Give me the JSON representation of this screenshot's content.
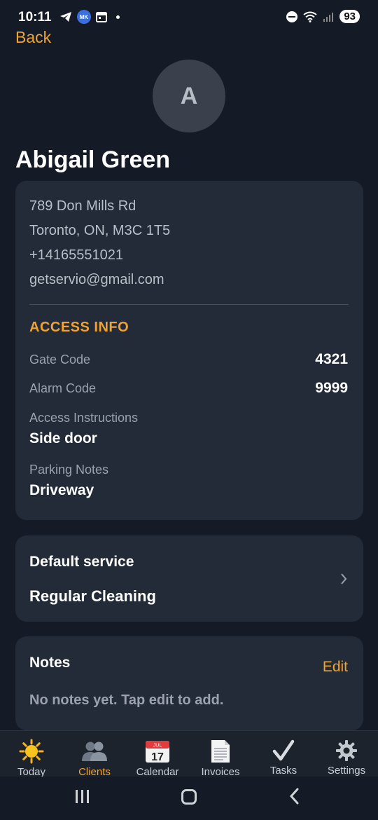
{
  "status": {
    "time": "10:11",
    "badge": "MK",
    "battery": "93"
  },
  "header": {
    "back_label": "Back"
  },
  "client": {
    "avatar_letter": "A",
    "name": "Abigail Green",
    "address_line1": "789 Don Mills Rd",
    "address_line2": "Toronto, ON, M3C 1T5",
    "phone": "+14165551021",
    "email": "getservio@gmail.com"
  },
  "access": {
    "title": "ACCESS INFO",
    "gate_label": "Gate Code",
    "gate_value": "4321",
    "alarm_label": "Alarm Code",
    "alarm_value": "9999",
    "instructions_label": "Access Instructions",
    "instructions_value": "Side door",
    "parking_label": "Parking Notes",
    "parking_value": "Driveway"
  },
  "service": {
    "label": "Default service",
    "value": "Regular Cleaning"
  },
  "notes": {
    "title": "Notes",
    "edit_label": "Edit",
    "empty_text": "No notes yet. Tap edit to add."
  },
  "tabs": [
    {
      "label": "Today",
      "icon": "sun-icon"
    },
    {
      "label": "Clients",
      "icon": "people-icon"
    },
    {
      "label": "Calendar",
      "icon": "calendar-icon",
      "date": "17",
      "month": "JUL"
    },
    {
      "label": "Invoices",
      "icon": "document-icon"
    },
    {
      "label": "Tasks",
      "icon": "checkmark-icon"
    },
    {
      "label": "Settings",
      "icon": "gear-icon"
    }
  ],
  "colors": {
    "accent": "#f0a332",
    "background": "#141b26",
    "card": "#222b37"
  }
}
